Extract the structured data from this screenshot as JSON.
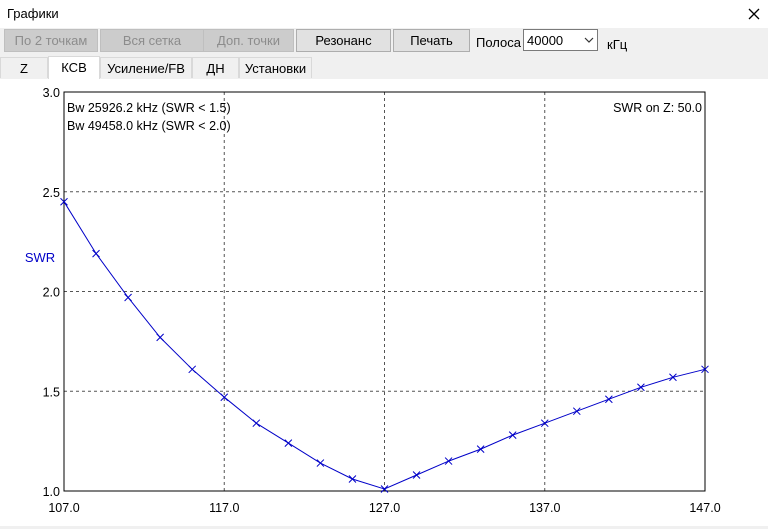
{
  "window": {
    "title": "Графики"
  },
  "toolbar": {
    "by_two_points": "По 2 точкам",
    "full_grid": "Вся сетка",
    "extra_points": "Доп. точки",
    "resonance": "Резонанс",
    "print": "Печать",
    "band_label": "Полоса",
    "band_value": "40000",
    "band_unit": "кГц"
  },
  "tabs": [
    "Z",
    "КСВ",
    "Усиление/FB",
    "ДН",
    "Установки"
  ],
  "active_tab": "КСВ",
  "plot": {
    "ylabel": "SWR",
    "info_lines": [
      "Bw 25926.2 kHz (SWR < 1.5)",
      "Bw 49458.0 kHz (SWR < 2.0)"
    ],
    "swr_on_z": "SWR on Z: 50.0"
  },
  "chart_data": {
    "type": "line",
    "xlabel": "",
    "ylabel": "SWR",
    "xlim": [
      107.0,
      147.0
    ],
    "ylim": [
      1.0,
      3.0
    ],
    "x_ticks": [
      "107.0",
      "117.0",
      "127.0",
      "137.0",
      "147.0"
    ],
    "y_ticks": [
      "1.0",
      "1.5",
      "2.0",
      "2.5",
      "3.0"
    ],
    "grid": true,
    "series": [
      {
        "color": "#0000c8",
        "x": [
          107.0,
          109.0,
          111.0,
          113.0,
          115.0,
          117.0,
          119.0,
          121.0,
          123.0,
          125.0,
          127.0,
          129.0,
          131.0,
          133.0,
          135.0,
          137.0,
          139.0,
          141.0,
          143.0,
          145.0,
          147.0
        ],
        "y": [
          2.45,
          2.19,
          1.97,
          1.77,
          1.61,
          1.47,
          1.34,
          1.24,
          1.14,
          1.06,
          1.01,
          1.08,
          1.15,
          1.21,
          1.28,
          1.34,
          1.4,
          1.46,
          1.52,
          1.57,
          1.61
        ]
      }
    ]
  }
}
